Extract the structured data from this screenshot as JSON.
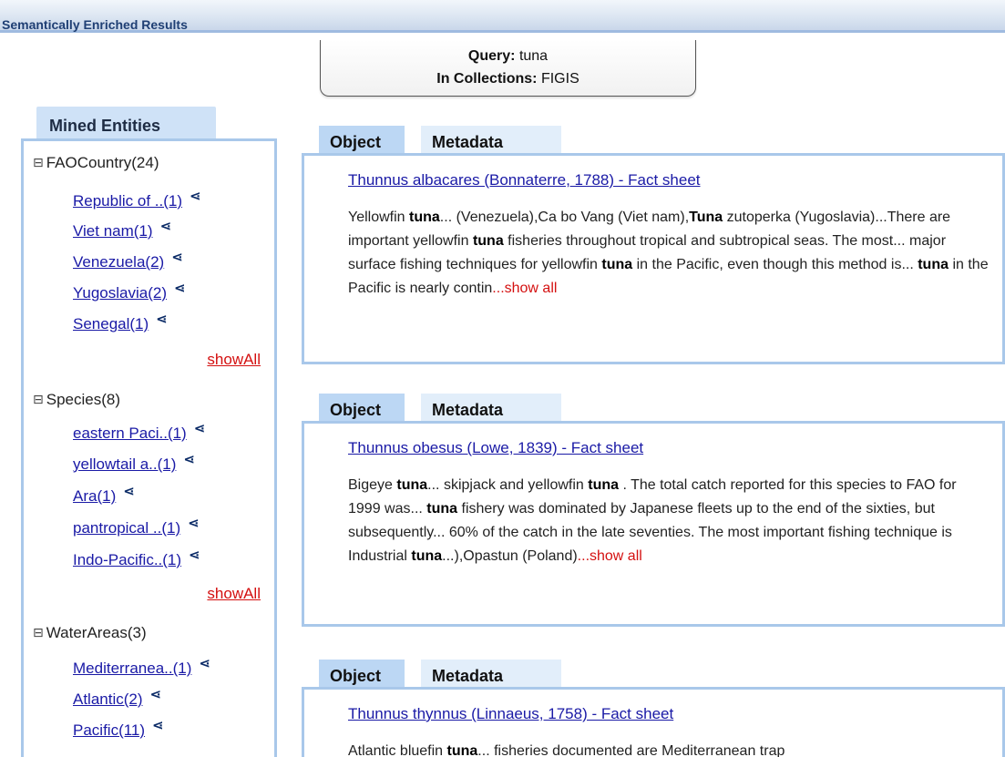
{
  "header": {
    "title": "Semantically Enriched Results"
  },
  "query": {
    "query_label": "Query:",
    "query_value": "tuna",
    "collections_label": "In Collections:",
    "collections_value": "FIGIS"
  },
  "sidebar": {
    "tab_label": "Mined Entities",
    "toggle_glyph": "⊟",
    "share_glyph": "⋖",
    "categories": [
      {
        "label": "FAOCountry(24)",
        "items": [
          "Republic of ..(1)",
          "Viet nam(1)",
          "Venezuela(2)",
          "Yugoslavia(2)",
          "Senegal(1)"
        ],
        "show_all": "showAll"
      },
      {
        "label": "Species(8)",
        "items": [
          "eastern Paci..(1)",
          "yellowtail a..(1)",
          "Ara(1)",
          "pantropical ..(1)",
          "Indo-Pacific..(1)"
        ],
        "show_all": "showAll"
      },
      {
        "label": "WaterAreas(3)",
        "items": [
          "Mediterranea..(1)",
          "Atlantic(2)",
          "Pacific(11)"
        ]
      }
    ]
  },
  "results": [
    {
      "tab_object": "Object",
      "tab_metadata": "Metadata",
      "title": "Thunnus albacares (Bonnaterre, 1788) - Fact sheet",
      "snippet": [
        {
          "t": "Yellowfin "
        },
        {
          "b": "tuna"
        },
        {
          "t": "... (Venezuela),Ca bo Vang (Viet nam),"
        },
        {
          "b": "Tuna"
        },
        {
          "t": " zutoperka (Yugoslavia)...There are important yellowfin "
        },
        {
          "b": "tuna"
        },
        {
          "t": " fisheries throughout tropical and subtropical seas. The most... major surface fishing techniques for yellowfin "
        },
        {
          "b": "tuna"
        },
        {
          "t": " in the Pacific, even though this method is... "
        },
        {
          "b": "tuna"
        },
        {
          "t": " in the Pacific is nearly contin"
        }
      ],
      "more": "...show all"
    },
    {
      "tab_object": "Object",
      "tab_metadata": "Metadata",
      "title": "Thunnus obesus (Lowe, 1839) - Fact sheet",
      "snippet": [
        {
          "t": "Bigeye "
        },
        {
          "b": "tuna"
        },
        {
          "t": "... skipjack and yellowfin "
        },
        {
          "b": "tuna"
        },
        {
          "t": " . The total catch reported for this species to FAO for 1999 was... "
        },
        {
          "b": "tuna"
        },
        {
          "t": " fishery was dominated by Japanese fleets up to the end of the sixties, but subsequently... 60% of the catch in the late seventies. The most important fishing technique is Industrial "
        },
        {
          "b": "tuna"
        },
        {
          "t": "...),Opastun (Poland)"
        }
      ],
      "more": "...show all"
    },
    {
      "tab_object": "Object",
      "tab_metadata": "Metadata",
      "title": "Thunnus thynnus (Linnaeus, 1758) - Fact sheet",
      "snippet": [
        {
          "t": "Atlantic bluefin "
        },
        {
          "b": "tuna"
        },
        {
          "t": "... fisheries documented are Mediterranean trap"
        }
      ],
      "more": ""
    }
  ]
}
